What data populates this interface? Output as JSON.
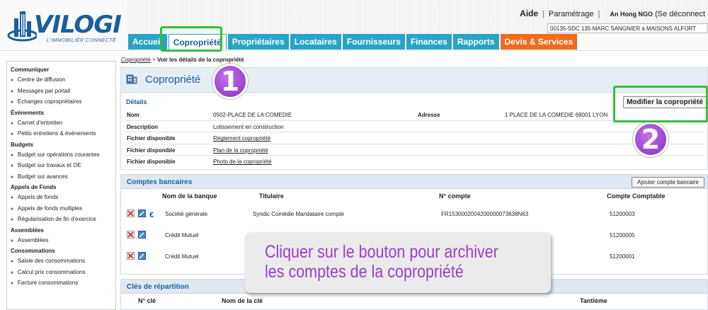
{
  "app": {
    "logo_text": "VILOGI",
    "logo_tagline": "L'IMMOBILIER CONNECTÉ"
  },
  "toplinks": {
    "aide": "Aide",
    "parametrage": "Paramétrage",
    "user": "An Hong NGO",
    "logout": "(Se déconnect"
  },
  "lot_selector": {
    "value": "00135-SDC 135 MARC SANGNIER à MAISONS ALFORT"
  },
  "tabs": [
    {
      "label": "Accueil"
    },
    {
      "label": "Copropriété"
    },
    {
      "label": "Propriétaires"
    },
    {
      "label": "Locataires"
    },
    {
      "label": "Fournisseurs"
    },
    {
      "label": "Finances"
    },
    {
      "label": "Rapports"
    },
    {
      "label": "Devis & Services"
    }
  ],
  "sidebar": {
    "communiquer": "Communiquer",
    "centre_diffusion": "Centre de diffusion",
    "messages_portail": "Messages par portail",
    "echanges": "Echanges copropriétaires",
    "evenements": "Évènements",
    "carnet": "Carnet d'entretien",
    "petits_entretiens": "Petits entretiens & évènements",
    "budgets": "Budgets",
    "budget_courantes": "Budget sur opérations courantes",
    "budget_travaux": "Budget sur travaux et OE",
    "budget_avances": "Budget sur avances",
    "appels_fonds": "Appels de Fonds",
    "appels_fonds_item": "Appels de fonds",
    "appels_multiples": "Appels de fonds multiples",
    "regularisation": "Régularisation de fin d'exercice",
    "assemblees": "Assemblées",
    "assemblees_item": "Assemblées",
    "consommations": "Consommations",
    "saisie_conso": "Saisie des consommations",
    "calcul_prix": "Calcul prix consommations",
    "facture_conso": "Facture consommations"
  },
  "breadcrumb": {
    "root": "Copropriété",
    "sep": ">",
    "current": "Voir les détails de la copropriété"
  },
  "page_title": "Copropriété",
  "details": {
    "section_title": "Détails",
    "modify_button": "Modifier la copropriété",
    "nom_label": "Nom",
    "nom_value": "0502-PLACE DE LA COMEDIE",
    "adresse_label": "Adresse",
    "adresse_value": "1 PLACE DE LA COMEDIE 69001 LYON",
    "description_label": "Description",
    "description_value": "Lotissement en construction",
    "files": [
      {
        "label": "Fichier disponible",
        "link": "Règlement copropriété"
      },
      {
        "label": "Fichier disponible",
        "link": "Plan de la copropriété"
      },
      {
        "label": "Fichier disponible",
        "link": "Photo de la copropriété"
      }
    ]
  },
  "bank_accounts": {
    "section_title": "Comptes bancaires",
    "add_button": "Ajouter compte bancaire",
    "col_bank": "Nom de la banque",
    "col_holder": "Titulaire",
    "col_account": "N° compte",
    "col_ledger": "Compte Comptable",
    "rows": [
      {
        "bank": "Société générale",
        "holder": "Syndic Comédie Mandataire compte",
        "account": "FR1530002004200000073638N63",
        "ledger": "51200003"
      },
      {
        "bank": "Crédit Mutuel",
        "holder": "",
        "account": "",
        "ledger": "51200005"
      },
      {
        "bank": "Crédit Mutuel",
        "holder": "",
        "account": "",
        "ledger": "51200001"
      }
    ]
  },
  "repartition": {
    "section_title": "Clés de répartition",
    "col_num": "N° clé",
    "col_name": "Nom de la clé",
    "col_tantieme": "Tantième"
  },
  "annotations": {
    "badge_1": "1",
    "badge_2": "2",
    "callout_line1": "Cliquer sur le bouton pour archiver",
    "callout_line2": "les comptes de la copropriété",
    "highlight_color": "#33c038",
    "badge_color": "#9b3ec9"
  }
}
